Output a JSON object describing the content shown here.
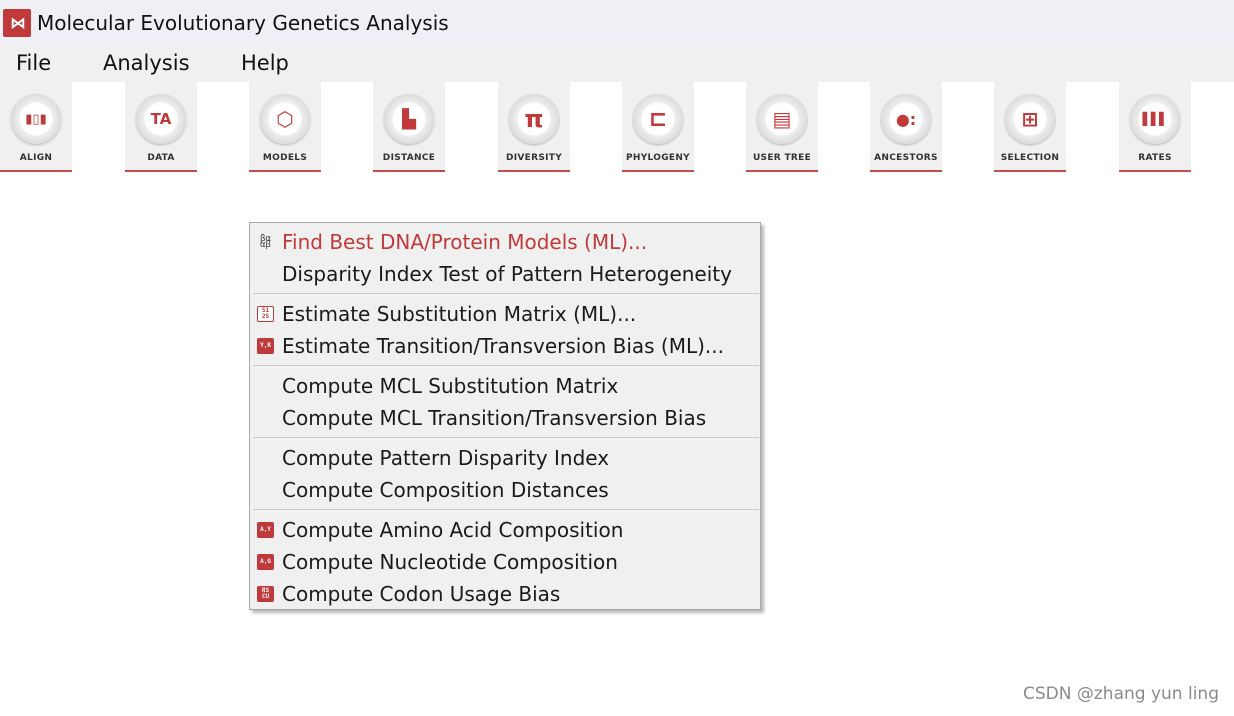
{
  "window": {
    "title": "Molecular Evolutionary Genetics Analysis",
    "logo_text": "M"
  },
  "menubar": {
    "items": [
      "File",
      "Analysis",
      "Help"
    ]
  },
  "toolbar": {
    "accent_color": "#c0393b",
    "tools": [
      {
        "label": "ALIGN",
        "icon": "align-icon",
        "glyph": "▮▯▮"
      },
      {
        "label": "DATA",
        "icon": "data-icon",
        "glyph": "TA"
      },
      {
        "label": "MODELS",
        "icon": "models-icon",
        "glyph": "⬡"
      },
      {
        "label": "DISTANCE",
        "icon": "distance-icon",
        "glyph": "▙"
      },
      {
        "label": "DIVERSITY",
        "icon": "diversity-icon",
        "glyph": "π"
      },
      {
        "label": "PHYLOGENY",
        "icon": "phylogeny-icon",
        "glyph": "⊏"
      },
      {
        "label": "USER TREE",
        "icon": "user-tree-icon",
        "glyph": "▤"
      },
      {
        "label": "ANCESTORS",
        "icon": "ancestors-icon",
        "glyph": "●:"
      },
      {
        "label": "SELECTION",
        "icon": "selection-icon",
        "glyph": "⊞"
      },
      {
        "label": "RATES",
        "icon": "rates-icon",
        "glyph": "▌▌▌"
      }
    ]
  },
  "context_menu": {
    "items": [
      {
        "label": "Find Best DNA/Protein Models (ML)...",
        "icon": "alpha-beta-icon",
        "icon_text": "βα αβ",
        "icon_style": "plain",
        "highlighted": true
      },
      {
        "label": "Disparity Index Test of Pattern Heterogeneity",
        "icon": "",
        "icon_text": ""
      },
      {
        "label": "Estimate Substitution Matrix (ML)...",
        "icon": "substitution-matrix-icon",
        "icon_text": "S1 2S",
        "icon_style": "outline"
      },
      {
        "label": "Estimate Transition/Transversion Bias (ML)...",
        "icon": "yr-icon",
        "icon_text": "Y,R"
      },
      {
        "label": "Compute MCL Substitution Matrix",
        "icon": "",
        "icon_text": ""
      },
      {
        "label": "Compute MCL Transition/Transversion Bias",
        "icon": "",
        "icon_text": ""
      },
      {
        "label": "Compute Pattern Disparity Index",
        "icon": "",
        "icon_text": ""
      },
      {
        "label": "Compute Composition Distances",
        "icon": "",
        "icon_text": ""
      },
      {
        "label": "Compute Amino Acid Composition",
        "icon": "amino-acid-icon",
        "icon_text": "A,Y"
      },
      {
        "label": "Compute Nucleotide Composition",
        "icon": "nucleotide-icon",
        "icon_text": "A,G"
      },
      {
        "label": "Compute Codon Usage Bias",
        "icon": "codon-icon",
        "icon_text": "RS CU"
      }
    ]
  },
  "watermark": "CSDN @zhang yun ling"
}
